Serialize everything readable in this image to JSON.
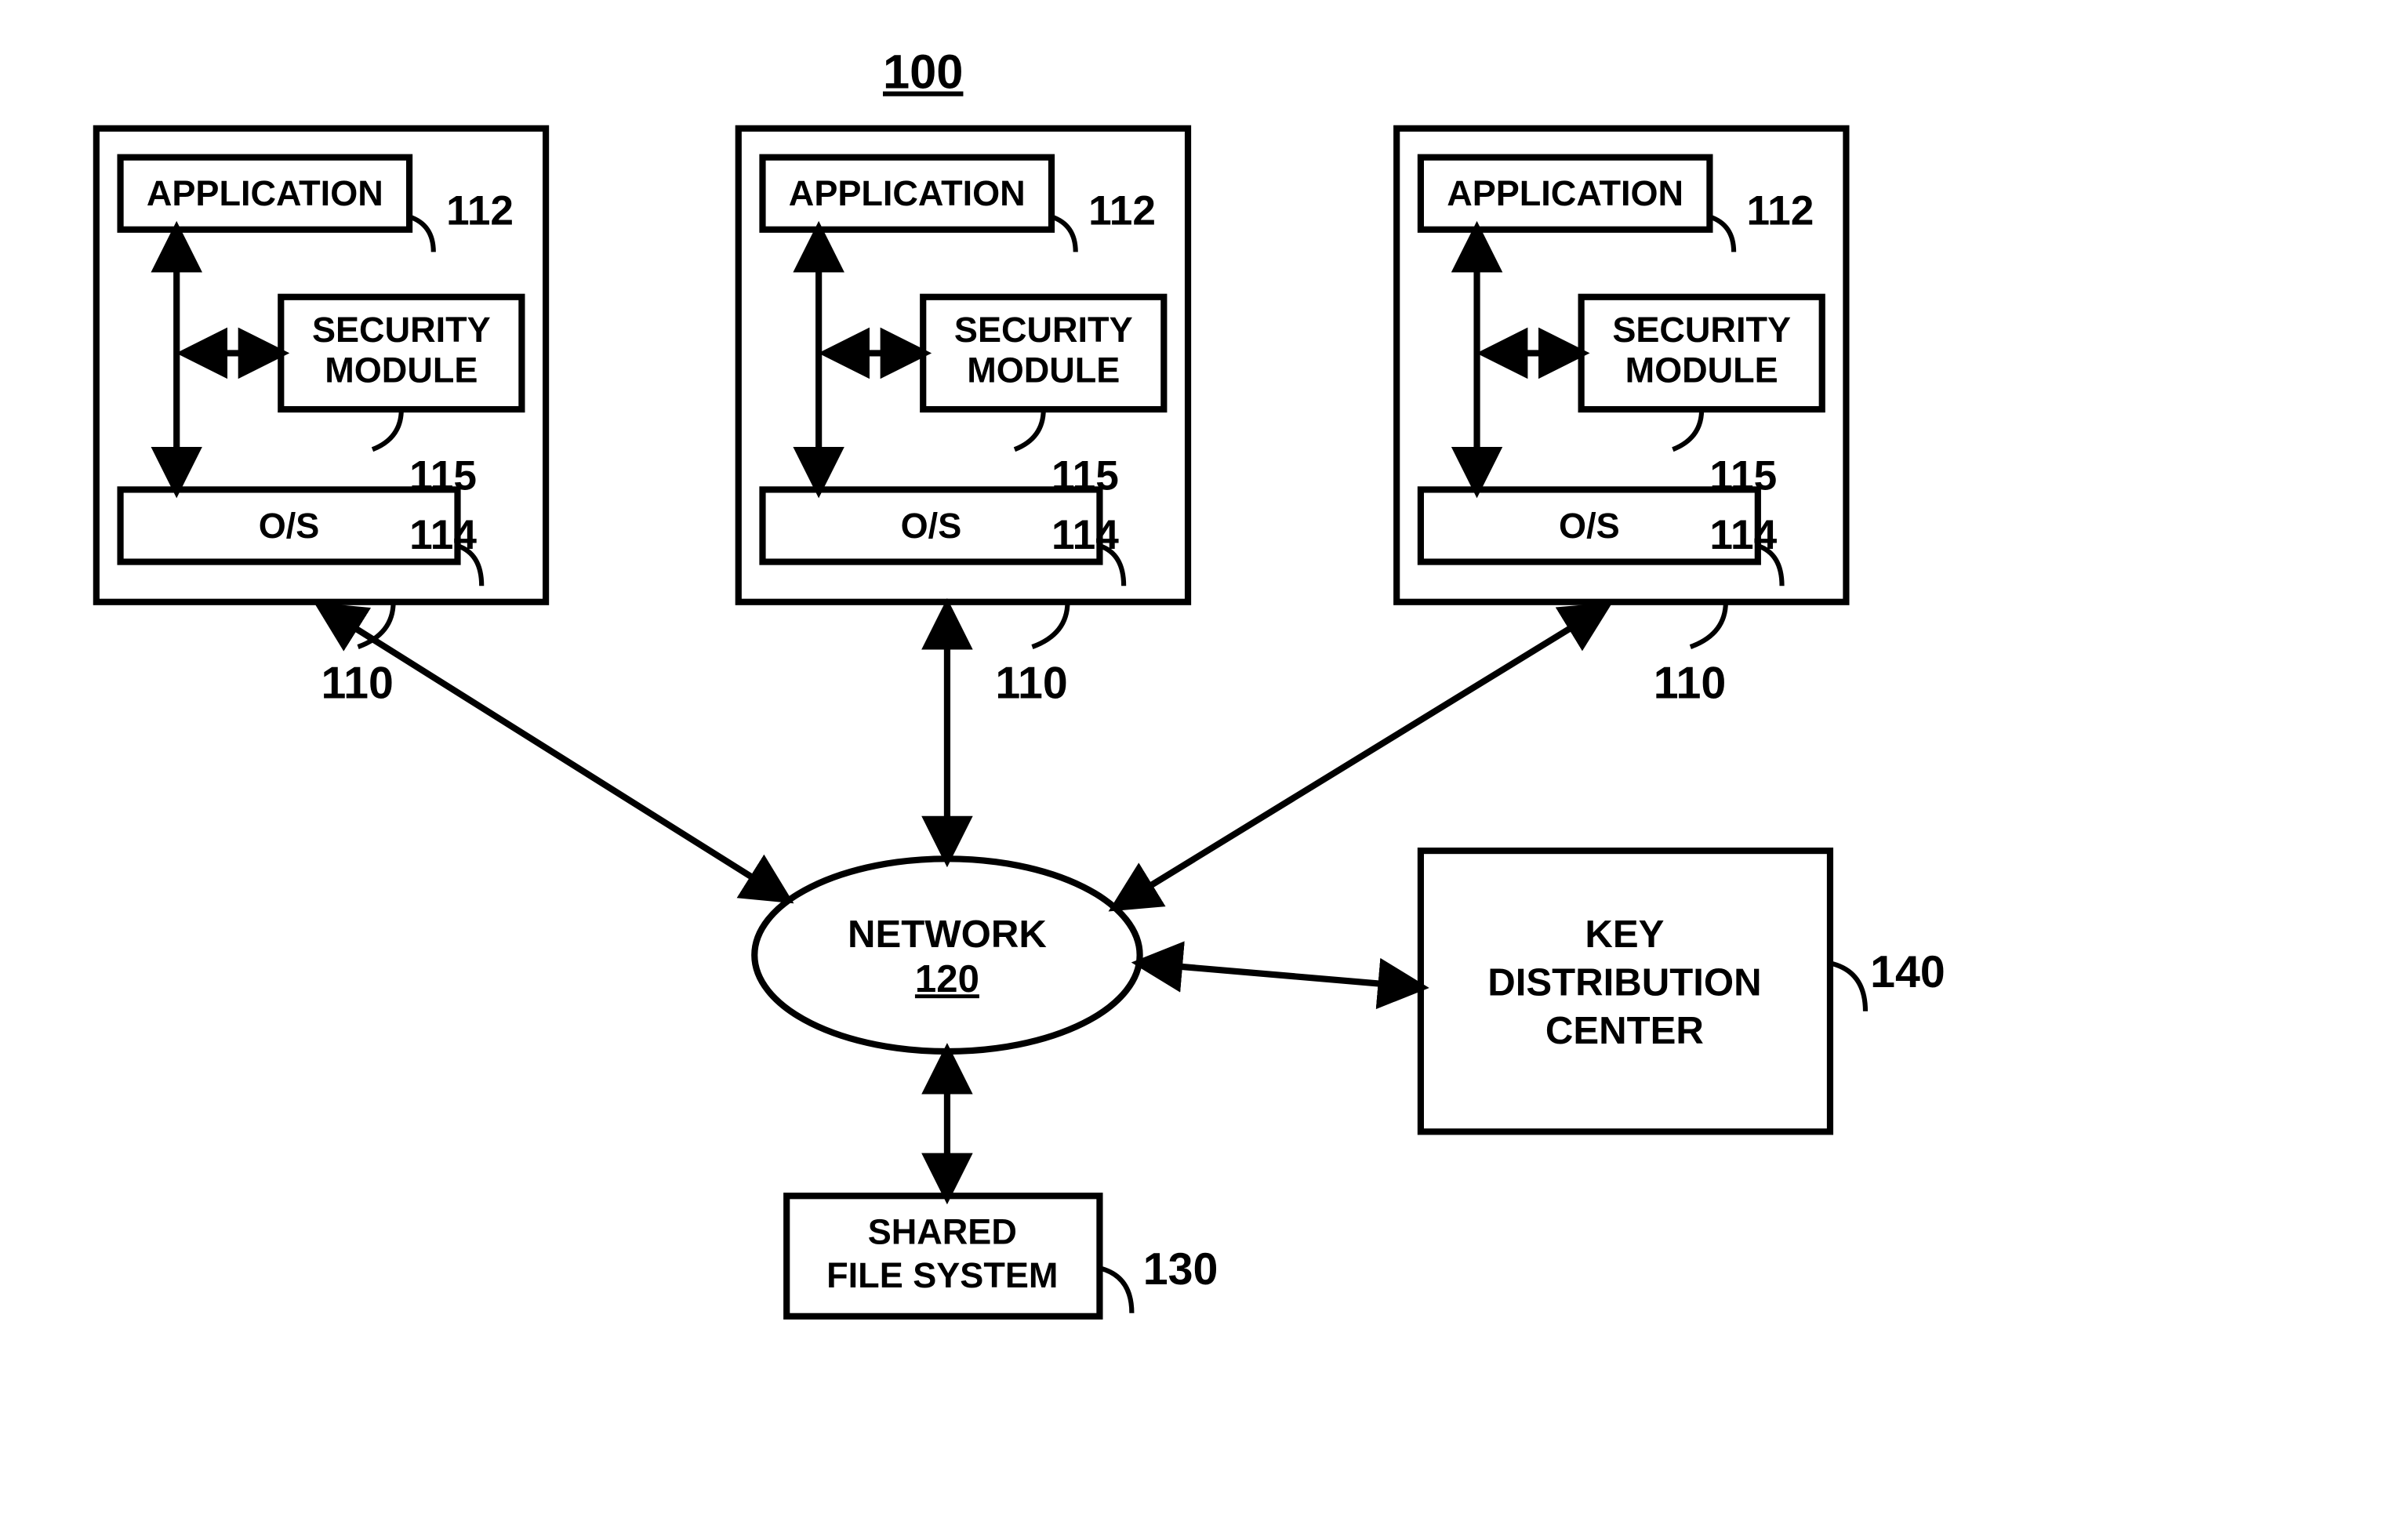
{
  "figure_ref": "100",
  "node": {
    "application": "APPLICATION",
    "security_module_l1": "SECURITY",
    "security_module_l2": "MODULE",
    "os": "O/S",
    "network_l1": "NETWORK",
    "network_l2": "120",
    "kdc_l1": "KEY",
    "kdc_l2": "DISTRIBUTION",
    "kdc_l3": "CENTER",
    "shared_l1": "SHARED",
    "shared_l2": "FILE SYSTEM"
  },
  "ref": {
    "application": "112",
    "security_module": "115",
    "os": "114",
    "client_box": "110",
    "shared_fs": "130",
    "kdc": "140"
  }
}
